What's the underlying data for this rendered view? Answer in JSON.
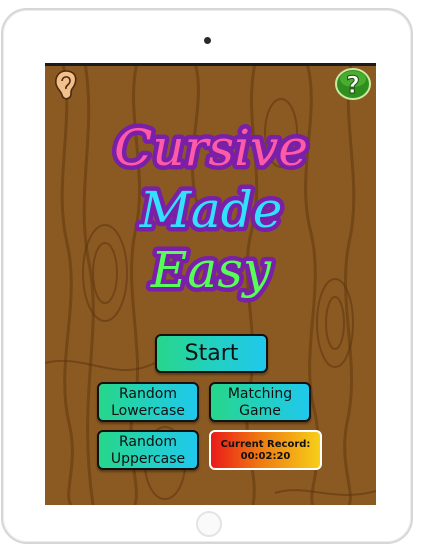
{
  "app": {
    "title_lines": [
      "Cursive",
      "Made",
      "Easy"
    ]
  },
  "buttons": {
    "start_label": "Start",
    "random_lowercase": [
      "Random",
      "Lowercase"
    ],
    "matching_game": [
      "Matching",
      "Game"
    ],
    "random_uppercase": [
      "Random",
      "Uppercase"
    ]
  },
  "record": {
    "label": "Current Record:",
    "time": "00:02:20"
  },
  "icons": {
    "top_left": "ear-icon",
    "top_right": "help-question-icon"
  },
  "colors": {
    "background_wood": "#8b5a22",
    "title_cursive": "#ff5aa8",
    "title_made": "#33e0ff",
    "title_easy": "#55ff55",
    "title_outline": "#7a1fa8",
    "button_gradient_start": "#27d68a",
    "button_gradient_end": "#20c8ec",
    "record_gradient_start": "#ea1a1a",
    "record_gradient_end": "#f6cf1a",
    "help_button": "#2e8f1e"
  }
}
